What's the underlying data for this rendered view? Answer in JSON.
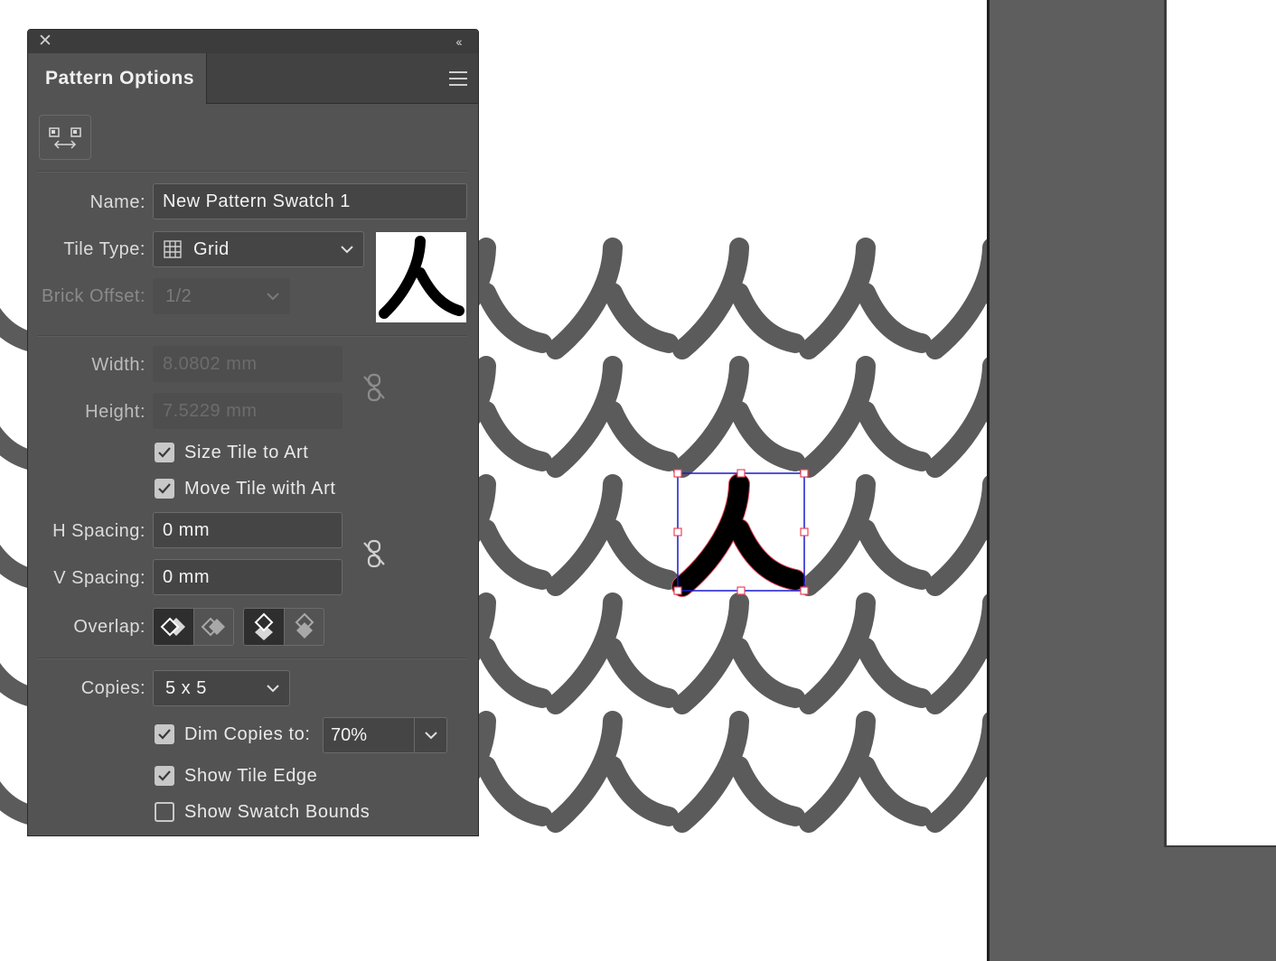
{
  "panel": {
    "title": "Pattern Options",
    "name_label": "Name:",
    "name_value": "New Pattern Swatch 1",
    "tile_type_label": "Tile Type:",
    "tile_type_value": "Grid",
    "brick_offset_label": "Brick Offset:",
    "brick_offset_value": "1/2",
    "width_label": "Width:",
    "width_value": "8.0802 mm",
    "height_label": "Height:",
    "height_value": "7.5229 mm",
    "size_tile_label": "Size Tile to Art",
    "size_tile_checked": true,
    "move_tile_label": "Move Tile with Art",
    "move_tile_checked": true,
    "h_spacing_label": "H Spacing:",
    "h_spacing_value": "0 mm",
    "v_spacing_label": "V Spacing:",
    "v_spacing_value": "0 mm",
    "overlap_label": "Overlap:",
    "copies_label": "Copies:",
    "copies_value": "5 x 5",
    "dim_copies_label": "Dim Copies to:",
    "dim_copies_checked": true,
    "dim_copies_value": "70%",
    "show_tile_edge_label": "Show Tile Edge",
    "show_tile_edge_checked": true,
    "show_swatch_bounds_label": "Show Swatch Bounds",
    "show_swatch_bounds_checked": false
  },
  "pattern": {
    "glyph": "人",
    "copy_color": "#5b5b5b",
    "source_color": "#000000",
    "tile_edge_color": "#1a1acc",
    "selection_color": "#e8455a"
  },
  "icons": {
    "close": "close-icon",
    "collapse": "collapse-panel-icon",
    "menu": "panel-menu-icon",
    "edit_tile": "pattern-tile-tool-icon",
    "grid": "grid-tile-icon",
    "link": "link-broken-icon"
  }
}
